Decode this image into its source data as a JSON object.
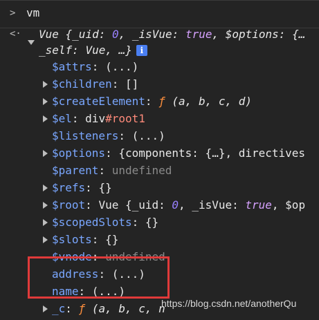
{
  "console": {
    "prompt_symbol": ">",
    "command": "vm",
    "return_symbol": "<·"
  },
  "summary": {
    "line1": {
      "ctor": "Vue",
      "brace": " {",
      "k1": "_uid",
      "v1": "0",
      "k2": "_isVue",
      "v2": "true",
      "k3": "$options",
      "v3": "{…"
    },
    "line2": {
      "k": "_self",
      "v": "Vue, …}"
    }
  },
  "properties": [
    {
      "key": "$attrs",
      "value": "(...)",
      "expandable": false
    },
    {
      "key": "$children",
      "value": "[]",
      "expandable": true
    },
    {
      "key": "$createElement",
      "value_fn": "ƒ",
      "value": "(a, b, c, d)",
      "expandable": true
    },
    {
      "key": "$el",
      "value": "div#root1",
      "expandable": true
    },
    {
      "key": "$listeners",
      "value": "(...)",
      "expandable": false
    },
    {
      "key": "$options",
      "value": "{components: {…}, directives",
      "expandable": true
    },
    {
      "key": "$parent",
      "value": "undefined",
      "expandable": false
    },
    {
      "key": "$refs",
      "value": "{}",
      "expandable": true
    },
    {
      "key": "$root",
      "value": "Vue {_uid: 0, _isVue: true, $op",
      "expandable": true
    },
    {
      "key": "$scopedSlots",
      "value": "{}",
      "expandable": true
    },
    {
      "key": "$slots",
      "value": "{}",
      "expandable": true
    },
    {
      "key": "$vnode",
      "value": "undefined",
      "expandable": false
    },
    {
      "key": "address",
      "value": "(...)",
      "expandable": false
    },
    {
      "key": "name",
      "value": "(...)",
      "expandable": false
    },
    {
      "key": "_c",
      "value_fn": "ƒ",
      "value": "(a, b, c, n",
      "expandable": true
    }
  ],
  "watermark": "https://blog.csdn.net/anotherQu",
  "colors": {
    "background": "#242424",
    "property_key": "#7aa7ff",
    "highlight_box": "#e03a3a",
    "info_badge": "#4a7ff2"
  }
}
